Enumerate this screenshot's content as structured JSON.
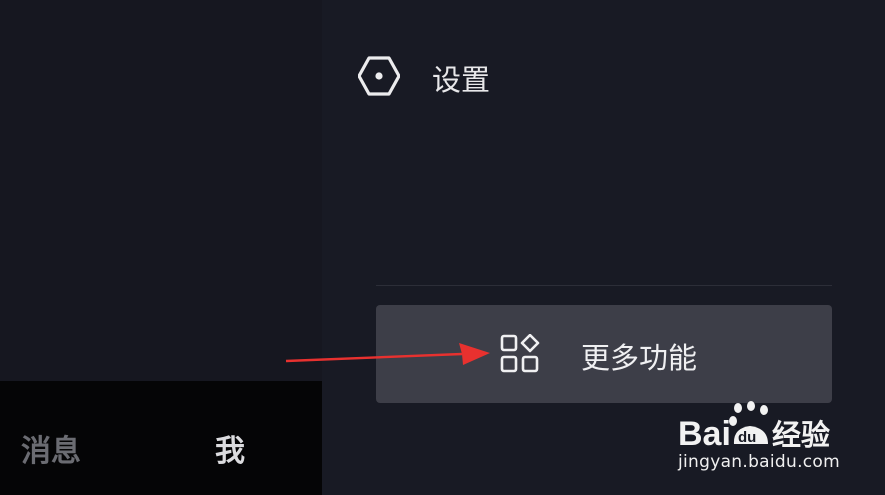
{
  "drawer": {
    "settings_label": "设置",
    "more_features_label": "更多功能"
  },
  "bottom_nav": {
    "messages_label": "消息",
    "me_label": "我"
  },
  "watermark": {
    "logo_text": "Baidu经验",
    "url": "jingyan.baidu.com"
  },
  "colors": {
    "drawer_bg": "#181a24",
    "menu_highlight": "#3d3e48",
    "arrow": "#e8312f"
  },
  "icons": [
    "settings-hexagon-icon",
    "apps-grid-icon",
    "red-arrow-annotation",
    "baidu-paw-icon"
  ]
}
